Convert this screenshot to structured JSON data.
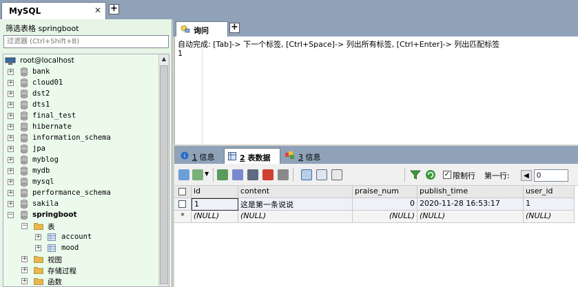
{
  "top_tabs": {
    "connection_label": "MySQL",
    "close_glyph": "✕",
    "add_glyph": "+"
  },
  "left_panel": {
    "filter_title": "筛选表格 springboot",
    "filter_placeholder": "过滤器 (Ctrl+Shift+B)",
    "tree": {
      "root": "root@localhost",
      "databases": [
        "bank",
        "cloud01",
        "dst2",
        "dts1",
        "final_test",
        "hibernate",
        "information_schema",
        "jpa",
        "myblog",
        "mydb",
        "mysql",
        "performance_schema",
        "sakila"
      ],
      "open_db": "springboot",
      "tables_folder": "表",
      "tables": [
        "account",
        "mood"
      ],
      "other_folders": [
        "视图",
        "存储过程",
        "函数"
      ]
    }
  },
  "query": {
    "tab_label": "询问",
    "add_glyph": "+",
    "hint": "自动完成: [Tab]-> 下一个标签, [Ctrl+Space]-> 列出所有标签, [Ctrl+Enter]-> 列出匹配标签",
    "line_number": "1"
  },
  "results": {
    "tabs": [
      {
        "num": "1",
        "label": "信息"
      },
      {
        "num": "2",
        "label": "表数据"
      },
      {
        "num": "3",
        "label": "信息"
      }
    ],
    "toolbar": {
      "limit_label": "限制行",
      "first_row_label": "第一行:",
      "first_row_value": "0",
      "prev_glyph": "◀",
      "check_glyph": "✓"
    },
    "columns": [
      "id",
      "content",
      "praise_num",
      "publish_time",
      "user_id"
    ],
    "rows": [
      {
        "marker": "",
        "id": "1",
        "content": "这是第一条说说",
        "praise_num": "0",
        "publish_time": "2020-11-28 16:53:17",
        "user_id": "1"
      },
      {
        "marker": "*",
        "id": "(NULL)",
        "content": "(NULL)",
        "praise_num": "(NULL)",
        "publish_time": "(NULL)",
        "user_id": "(NULL)"
      }
    ]
  },
  "colors": {
    "tab_bar": "#8fa2b8",
    "tree_bg": "#ecfaec",
    "folder": "#e8b84a",
    "db": "#b0b0b0"
  }
}
